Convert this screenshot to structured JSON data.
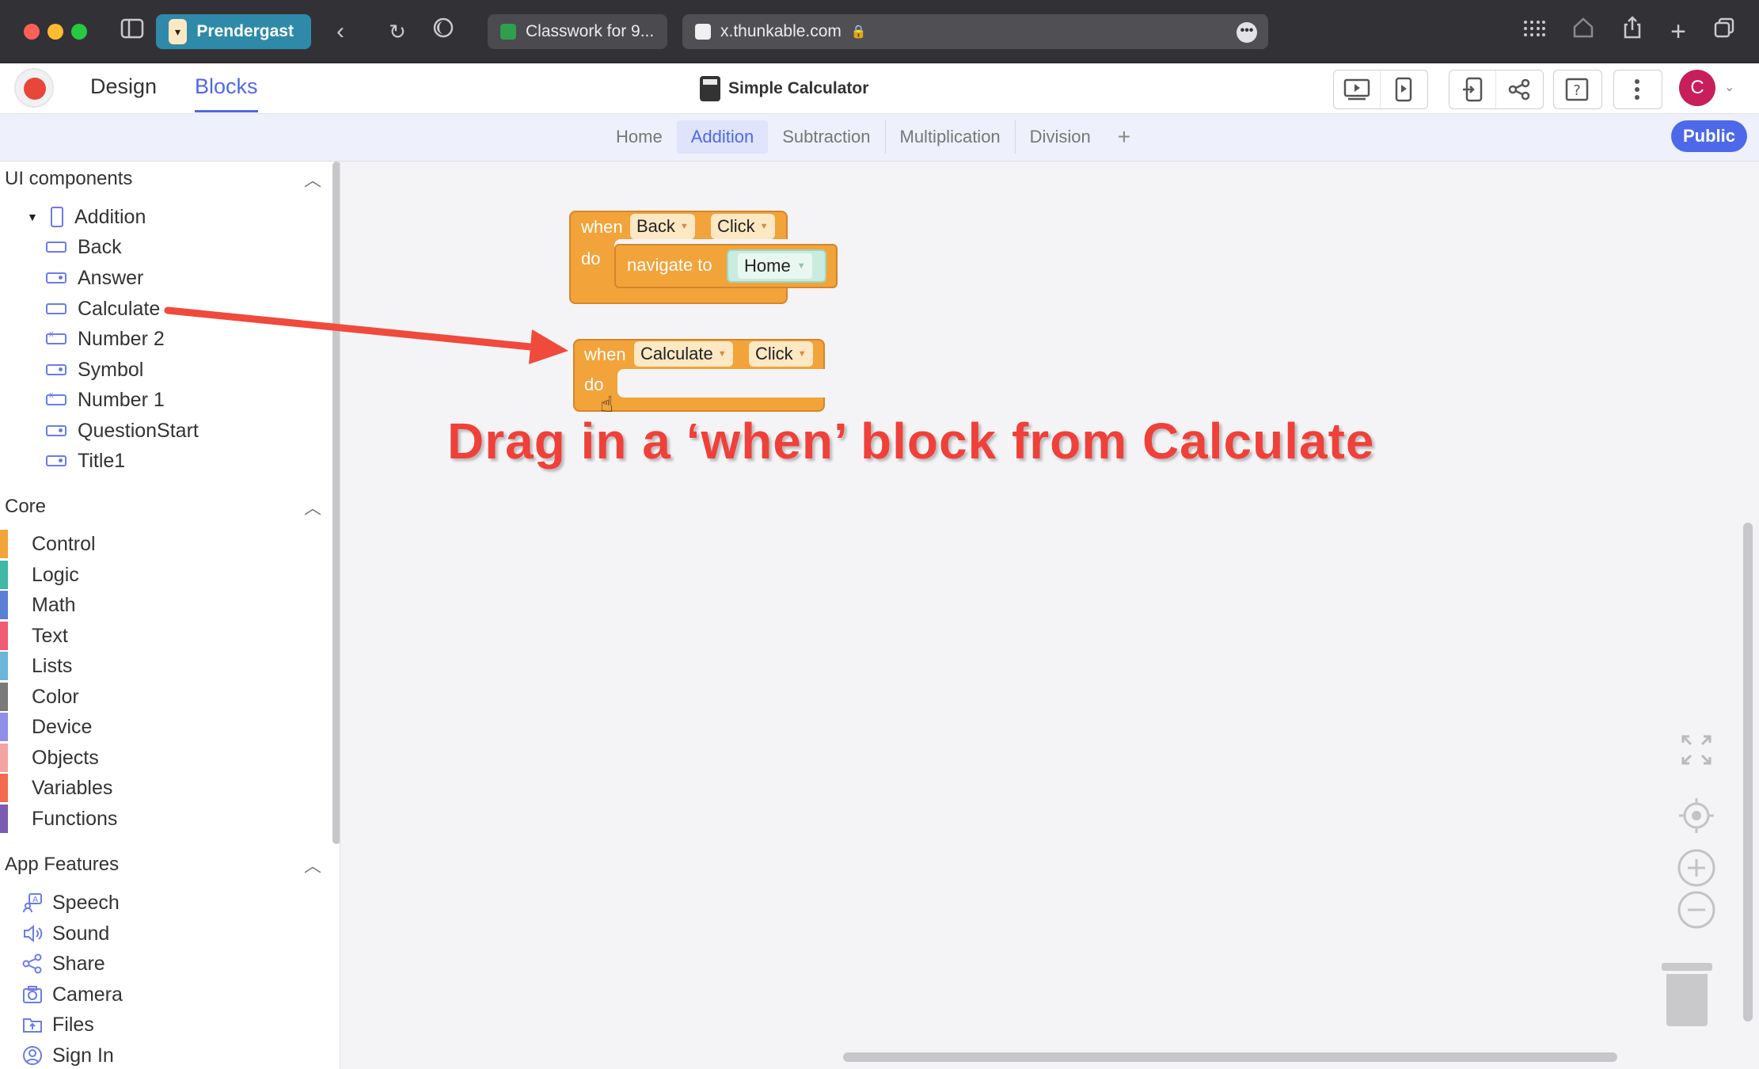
{
  "browser": {
    "profile_label": "Prendergast",
    "tabs": [
      {
        "title": "Classwork for 9...",
        "favicon_color": "#2f9e4f"
      },
      {
        "title": "x.thunkable.com",
        "favicon_color": "#f0f0f0"
      }
    ]
  },
  "app": {
    "nav": {
      "design": "Design",
      "blocks": "Blocks"
    },
    "project_title": "Simple Calculator",
    "avatar_letter": "C",
    "accent": "#4d68e8"
  },
  "screens": {
    "tabs": [
      "Home",
      "Addition",
      "Subtraction",
      "Multiplication",
      "Division"
    ],
    "active": "Addition",
    "add": "+",
    "public_label": "Public"
  },
  "sidebar": {
    "ui_components": {
      "title": "UI components",
      "root": "Addition",
      "items": [
        "Back",
        "Answer",
        "Calculate",
        "Number 2",
        "Symbol",
        "Number 1",
        "QuestionStart",
        "Title1"
      ]
    },
    "core": {
      "title": "Core",
      "items": [
        {
          "label": "Control",
          "color": "#f2a33a"
        },
        {
          "label": "Logic",
          "color": "#3fb8a5"
        },
        {
          "label": "Math",
          "color": "#5b7ed6"
        },
        {
          "label": "Text",
          "color": "#ef5b72"
        },
        {
          "label": "Lists",
          "color": "#6bb6da"
        },
        {
          "label": "Color",
          "color": "#7a7a7a"
        },
        {
          "label": "Device",
          "color": "#8f8fe8"
        },
        {
          "label": "Objects",
          "color": "#f4a3a3"
        },
        {
          "label": "Variables",
          "color": "#f26b4e"
        },
        {
          "label": "Functions",
          "color": "#7b5cb2"
        }
      ]
    },
    "app_features": {
      "title": "App Features",
      "items": [
        "Speech",
        "Sound",
        "Share",
        "Camera",
        "Files",
        "Sign In"
      ]
    }
  },
  "blocks": {
    "block1": {
      "when": "when",
      "component": "Back",
      "event": "Click",
      "do": "do",
      "action": "navigate to",
      "target": "Home"
    },
    "block2": {
      "when": "when",
      "component": "Calculate",
      "event": "Click",
      "do": "do"
    }
  },
  "annotation": {
    "text": "Drag in a ‘when’ block from Calculate",
    "color": "#f0403a"
  }
}
